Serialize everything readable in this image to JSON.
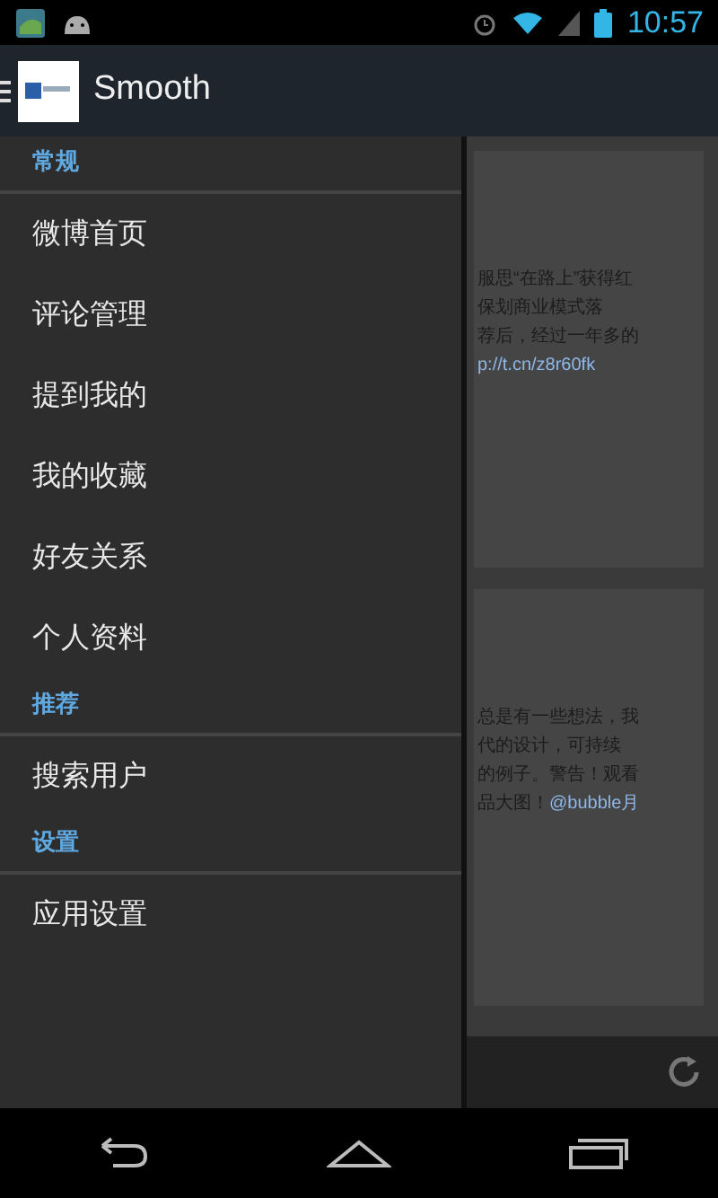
{
  "status_bar": {
    "time": "10:57"
  },
  "action_bar": {
    "title": "Smooth"
  },
  "drawer": {
    "sections": [
      {
        "header": "常规",
        "items": [
          "微博首页",
          "评论管理",
          "提到我的",
          "我的收藏",
          "好友关系",
          "个人资料"
        ]
      },
      {
        "header": "推荐",
        "items": [
          "搜索用户"
        ]
      },
      {
        "header": "设置",
        "items": [
          "应用设置"
        ]
      }
    ]
  },
  "background_cards": [
    {
      "lines": [
        "服思“在路上”获得红",
        "保划商业模式落",
        "荐后，经过一年多的"
      ],
      "link": "p://t.cn/z8r60fk"
    },
    {
      "lines": [
        "总是有一些想法，我",
        "代的设计，可持续",
        "的例子。警告！观看",
        "品大图！"
      ],
      "link": "@bubble月"
    }
  ]
}
